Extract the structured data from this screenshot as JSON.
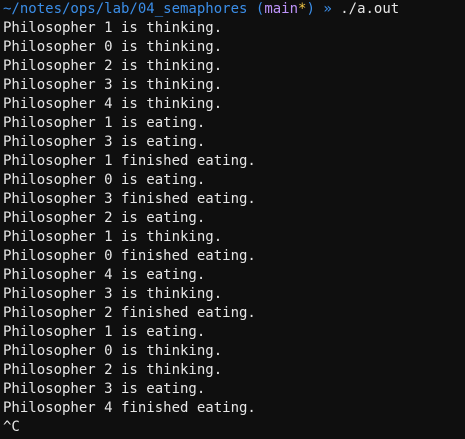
{
  "prompt": {
    "path": "~/notes/ops/lab/04_semaphores",
    "branch_open": "(",
    "branch": "main",
    "dirty_marker": "*",
    "branch_close": ")",
    "arrow": "»",
    "command": "./a.out"
  },
  "output": [
    "Philosopher 1 is thinking.",
    "Philosopher 0 is thinking.",
    "Philosopher 2 is thinking.",
    "Philosopher 3 is thinking.",
    "Philosopher 4 is thinking.",
    "Philosopher 1 is eating.",
    "Philosopher 3 is eating.",
    "Philosopher 1 finished eating.",
    "Philosopher 0 is eating.",
    "Philosopher 3 finished eating.",
    "Philosopher 2 is eating.",
    "Philosopher 1 is thinking.",
    "Philosopher 0 finished eating.",
    "Philosopher 4 is eating.",
    "Philosopher 3 is thinking.",
    "Philosopher 2 finished eating.",
    "Philosopher 1 is eating.",
    "Philosopher 0 is thinking.",
    "Philosopher 2 is thinking.",
    "Philosopher 3 is eating.",
    "Philosopher 4 finished eating."
  ],
  "interrupt": "^C",
  "colors": {
    "background": "#0f0f0f",
    "foreground": "#e7e7e7",
    "path": "#3b8ee8",
    "branch": "#bd93f9",
    "dirty": "#f2c744"
  }
}
